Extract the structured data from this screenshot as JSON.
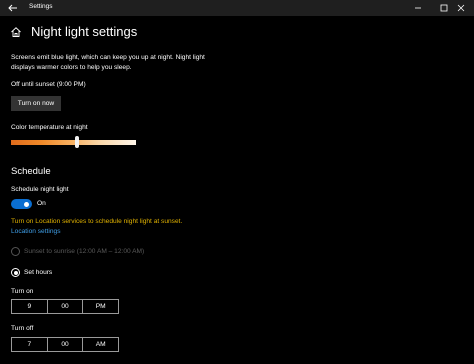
{
  "window": {
    "title": "Settings"
  },
  "page": {
    "title": "Night light settings"
  },
  "description": "Screens emit blue light, which can keep you up at night. Night light displays warmer colors to help you sleep.",
  "status_text": "Off until sunset (9:00 PM)",
  "turn_on_button": "Turn on now",
  "color_temperature": {
    "label": "Color temperature at night",
    "level_fraction": 0.53
  },
  "schedule": {
    "heading": "Schedule",
    "toggle_label": "Schedule night light",
    "toggle_state": "On",
    "warning": "Turn on Location services to schedule night light at sunset.",
    "location_link": "Location settings",
    "option_sunset": "Sunset to sunrise (12:00 AM – 12:00 AM)",
    "option_set_hours": "Set hours",
    "turn_on_label": "Turn on",
    "turn_on_time": {
      "hour": "9",
      "minute": "00",
      "period": "PM"
    },
    "turn_off_label": "Turn off",
    "turn_off_time": {
      "hour": "7",
      "minute": "00",
      "period": "AM"
    }
  },
  "colors": {
    "accent": "#0a6ed1",
    "warning": "#e1b200",
    "link": "#3f9fe8",
    "background": "#000000"
  },
  "icons": [
    "back-arrow-icon",
    "minimize-icon",
    "maximize-icon",
    "close-icon",
    "home-icon"
  ]
}
